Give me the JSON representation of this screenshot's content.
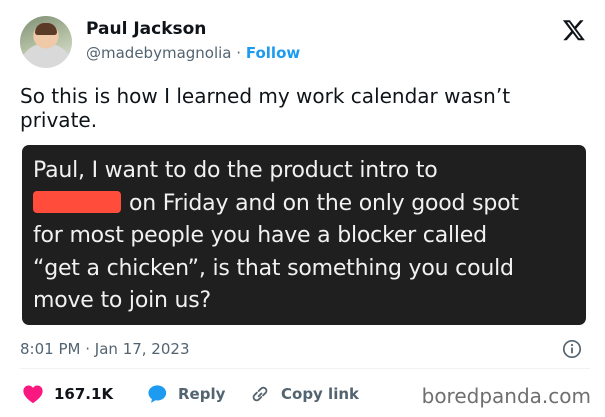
{
  "author": {
    "name": "Paul Jackson",
    "handle": "@madebymagnolia",
    "separator": "·",
    "follow_label": "Follow"
  },
  "tweet": {
    "text": "So this is how I learned my work calendar wasn’t private."
  },
  "quote_message": {
    "line1": "Paul, I want to do the product intro to",
    "line2_after_redaction": "on Friday and on the only good spot",
    "line3": "for most people you have a blocker called",
    "line4": "“get a chicken”, is that something you could",
    "line5": "move to join us?"
  },
  "meta": {
    "time": "8:01 PM",
    "separator": "·",
    "date": "Jan 17, 2023"
  },
  "actions": {
    "likes": "167.1K",
    "reply_label": "Reply",
    "copy_link_label": "Copy link"
  },
  "watermark": "boredpanda.com",
  "colors": {
    "follow": "#1d9bf0",
    "heart": "#f91880",
    "reply_bubble": "#1d9bf0",
    "quote_background": "#1f1f1f",
    "redaction": "#ff4c3b"
  },
  "icons": [
    "x-logo-icon",
    "info-icon",
    "heart-icon",
    "reply-bubble-icon",
    "link-icon"
  ]
}
